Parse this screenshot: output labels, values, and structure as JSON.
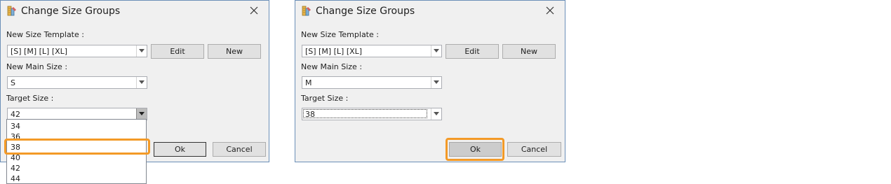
{
  "left_dialog": {
    "title": "Change Size Groups",
    "template_label": "New Size Template :",
    "template_value": "[S] [M] [L] [XL]",
    "edit_label": "Edit",
    "new_label": "New",
    "main_size_label": "New Main Size :",
    "main_size_value": "S",
    "target_size_label": "Target Size :",
    "target_size_value": "42",
    "dropdown_options": [
      "34",
      "36",
      "38",
      "40",
      "42",
      "44"
    ],
    "highlighted_option": "38",
    "ok_label": "Ok",
    "cancel_label": "Cancel"
  },
  "right_dialog": {
    "title": "Change Size Groups",
    "template_label": "New Size Template :",
    "template_value": "[S] [M] [L] [XL]",
    "edit_label": "Edit",
    "new_label": "New",
    "main_size_label": "New Main Size :",
    "main_size_value": "M",
    "target_size_label": "Target Size :",
    "target_size_value": "38",
    "ok_label": "Ok",
    "cancel_label": "Cancel"
  },
  "icons": {
    "app": "size-groups-app-icon",
    "close": "close-icon",
    "dropdown": "chevron-down-icon"
  },
  "colors": {
    "highlight": "#f39a27",
    "dialog_bg": "#f0f0f0",
    "border": "#6b8fb8"
  }
}
